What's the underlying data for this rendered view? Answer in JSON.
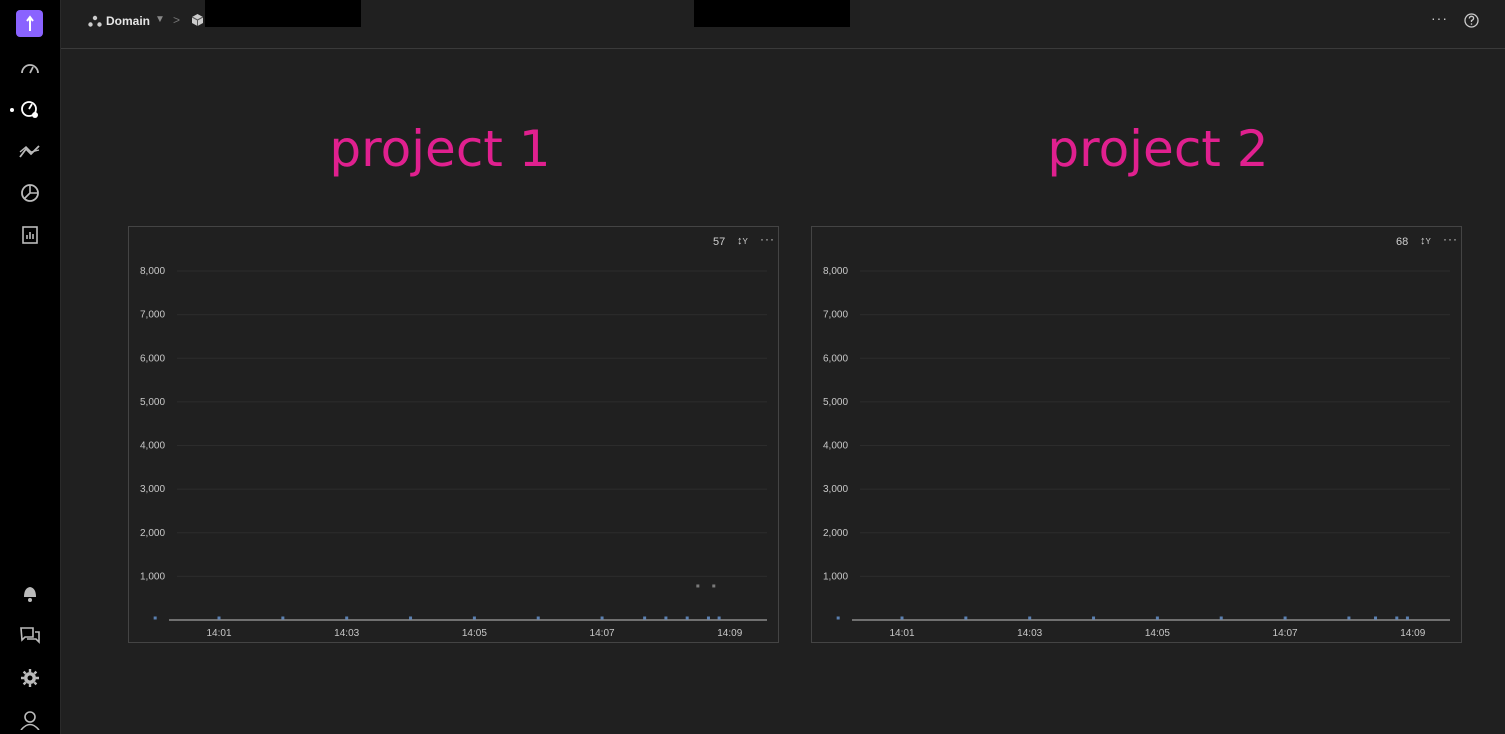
{
  "breadcrumb": {
    "domain_label": "Domain",
    "icons": [
      "hierarchy-icon",
      "chevron-down-icon",
      "chevron-right-icon",
      "cube-icon"
    ]
  },
  "topbar": {
    "more_label": "···",
    "help_icon": "help-circle-icon"
  },
  "sidebar": {
    "items": [
      {
        "icon": "dashboard-gauge-icon"
      },
      {
        "icon": "monitor-settings-icon",
        "active": true
      },
      {
        "icon": "trends-icon"
      },
      {
        "icon": "pie-chart-icon"
      },
      {
        "icon": "report-icon"
      }
    ],
    "bottom": [
      {
        "icon": "bell-icon"
      },
      {
        "icon": "chat-icon"
      },
      {
        "icon": "gear-icon"
      },
      {
        "icon": "user-icon"
      }
    ]
  },
  "projects": [
    {
      "title": "project 1",
      "count": "57",
      "sort_label": "Y"
    },
    {
      "title": "project 2",
      "count": "68",
      "sort_label": "Y"
    }
  ],
  "colors": {
    "accent": "#e0208f",
    "logo": "#8a63ff",
    "background": "#202020"
  },
  "chart_data": [
    {
      "type": "scatter",
      "title": "",
      "xlabel": "",
      "ylabel": "",
      "ylim": [
        0,
        8000
      ],
      "yticks": [
        "1,000",
        "2,000",
        "3,000",
        "4,000",
        "5,000",
        "6,000",
        "7,000",
        "8,000"
      ],
      "xticks": [
        "14:01",
        "14:03",
        "14:05",
        "14:07",
        "14:09"
      ],
      "series": [
        {
          "points": [
            [
              "14:00:00",
              20
            ],
            [
              "14:01:00",
              20
            ],
            [
              "14:02:00",
              20
            ],
            [
              "14:03:00",
              20
            ],
            [
              "14:04:00",
              20
            ],
            [
              "14:05:00",
              20
            ],
            [
              "14:06:00",
              20
            ],
            [
              "14:07:00",
              20
            ],
            [
              "14:07:40",
              20
            ],
            [
              "14:08:00",
              20
            ],
            [
              "14:08:20",
              20
            ],
            [
              "14:08:30",
              780
            ],
            [
              "14:08:45",
              780
            ],
            [
              "14:08:40",
              40
            ],
            [
              "14:08:50",
              40
            ]
          ]
        }
      ]
    },
    {
      "type": "scatter",
      "title": "",
      "xlabel": "",
      "ylabel": "",
      "ylim": [
        0,
        8000
      ],
      "yticks": [
        "1,000",
        "2,000",
        "3,000",
        "4,000",
        "5,000",
        "6,000",
        "7,000",
        "8,000"
      ],
      "xticks": [
        "14:01",
        "14:03",
        "14:05",
        "14:07",
        "14:09"
      ],
      "series": [
        {
          "points": [
            [
              "14:00:00",
              20
            ],
            [
              "14:01:00",
              20
            ],
            [
              "14:02:00",
              20
            ],
            [
              "14:03:00",
              20
            ],
            [
              "14:04:00",
              20
            ],
            [
              "14:05:00",
              20
            ],
            [
              "14:06:00",
              20
            ],
            [
              "14:07:00",
              20
            ],
            [
              "14:08:00",
              20
            ],
            [
              "14:08:25",
              20
            ],
            [
              "14:08:45",
              40
            ],
            [
              "14:08:55",
              40
            ]
          ]
        }
      ]
    }
  ]
}
